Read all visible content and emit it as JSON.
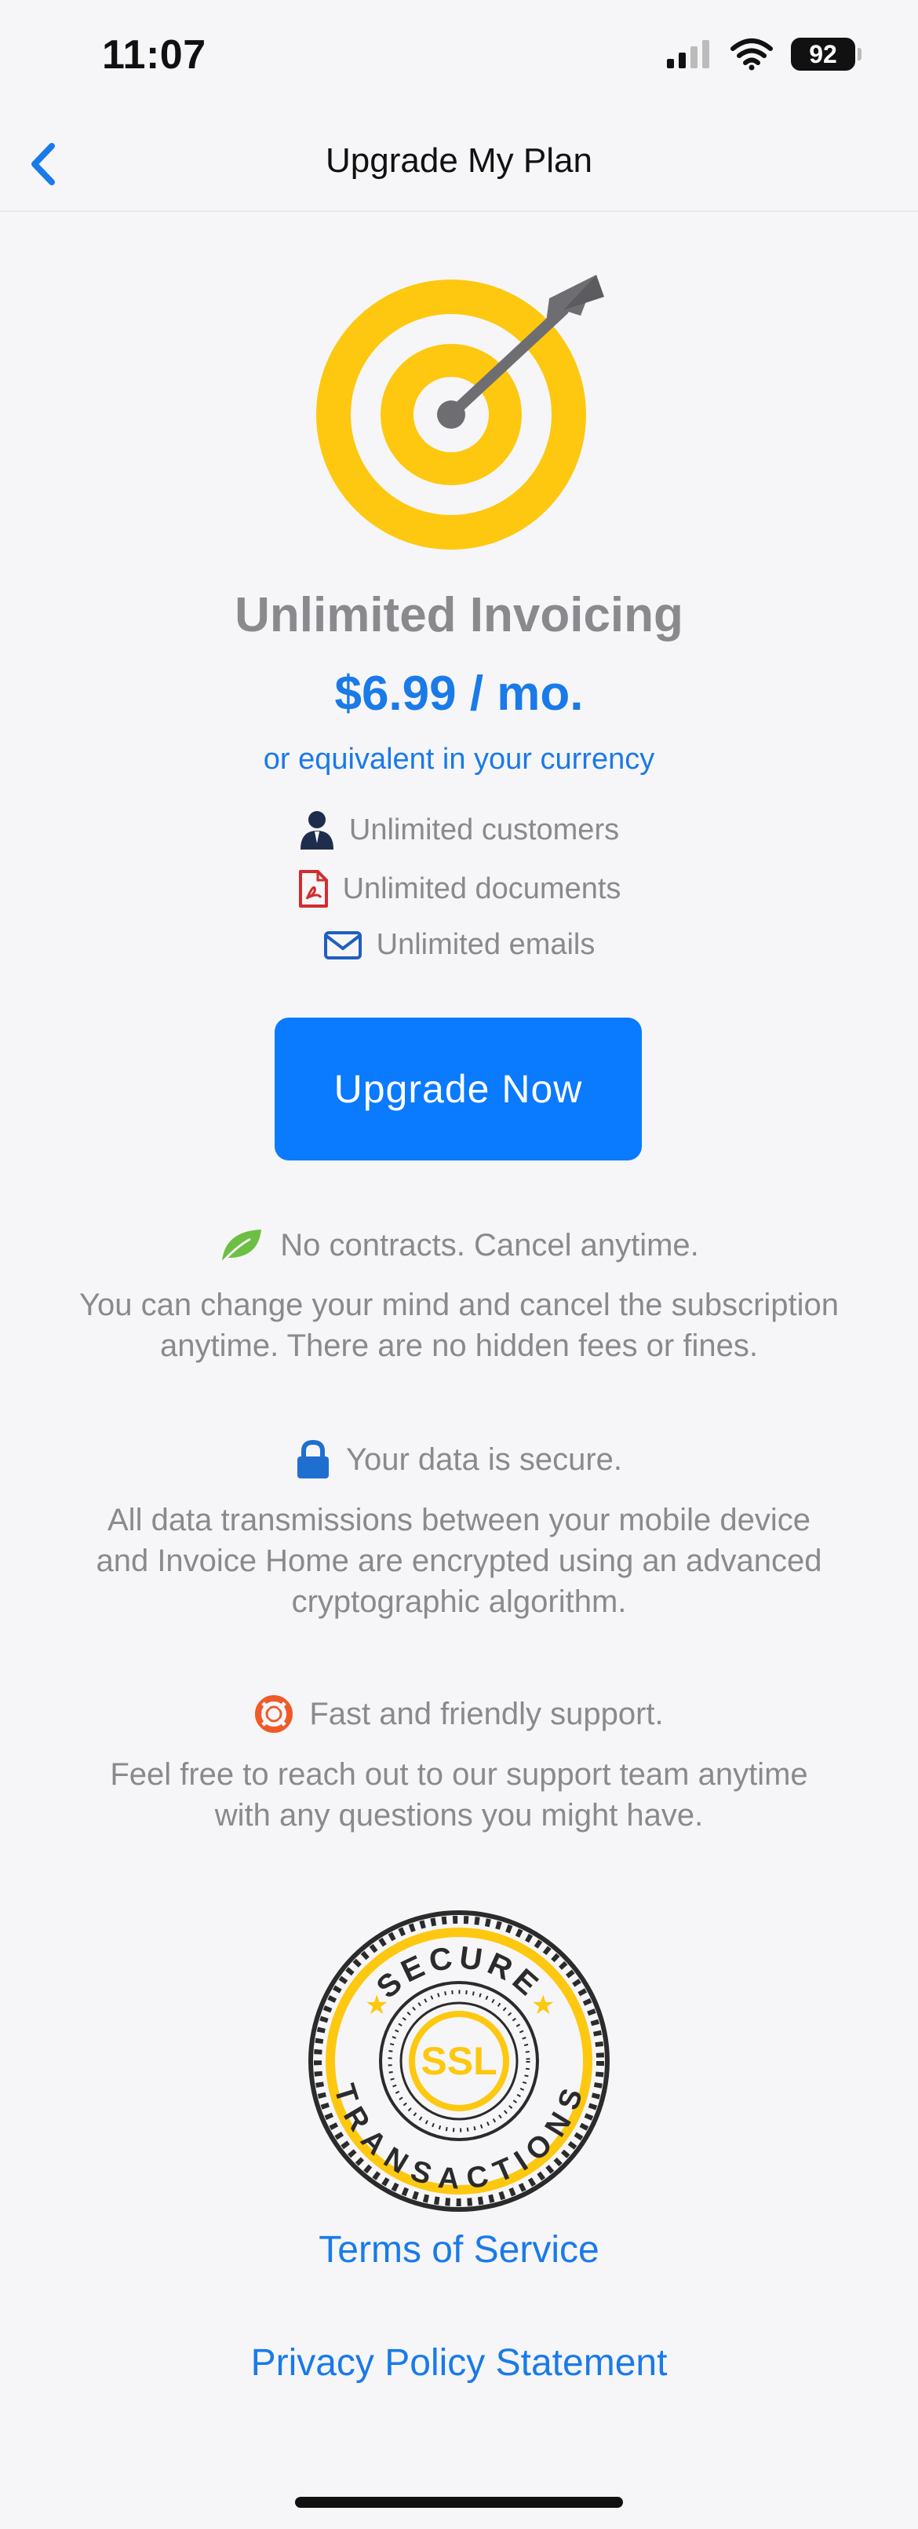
{
  "status_bar": {
    "time": "11:07",
    "battery": "92"
  },
  "nav": {
    "title": "Upgrade My Plan",
    "back_icon": "chevron-left-icon"
  },
  "plan": {
    "title": "Unlimited Invoicing",
    "price": "$6.99 / mo.",
    "currency_note": "or equivalent in your currency",
    "features": [
      {
        "icon": "user-icon",
        "label": "Unlimited customers"
      },
      {
        "icon": "pdf-document-icon",
        "label": "Unlimited documents"
      },
      {
        "icon": "envelope-icon",
        "label": "Unlimited emails"
      }
    ]
  },
  "upgrade_button": {
    "label": "Upgrade Now"
  },
  "sections": [
    {
      "icon": "leaf-icon",
      "heading": "No contracts. Cancel anytime.",
      "body_lines": [
        "You can change your mind and cancel the subscription",
        "anytime. There are no hidden fees or fines."
      ]
    },
    {
      "icon": "lock-icon",
      "heading": "Your data is secure.",
      "body_lines": [
        "All data transmissions between your mobile device",
        "and Invoice Home are encrypted using an advanced",
        "cryptographic algorithm."
      ]
    },
    {
      "icon": "lifebuoy-icon",
      "heading": "Fast and friendly support.",
      "body_lines": [
        "Feel free to reach out to our support team anytime",
        "with any questions you might have."
      ]
    }
  ],
  "seal": {
    "top_text": "SECURE",
    "center_text": "SSL",
    "bottom_text": "TRANSACTIONS"
  },
  "links": {
    "terms": "Terms of Service",
    "privacy": "Privacy Policy Statement"
  },
  "colors": {
    "accent": "#1a7ae8",
    "button": "#0a7aff",
    "target_yellow": "#fdc80f",
    "muted_text": "#8a8a8e"
  }
}
